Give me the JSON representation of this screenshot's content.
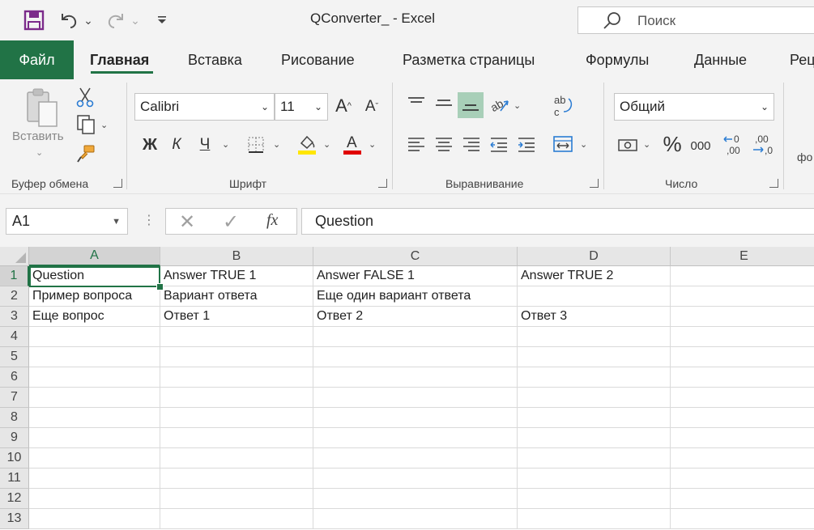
{
  "window": {
    "title": "QConverter_  -  Excel",
    "search_placeholder": "Поиск"
  },
  "ribbon_tabs": [
    "Файл",
    "Главная",
    "Вставка",
    "Рисование",
    "Разметка страницы",
    "Формулы",
    "Данные",
    "Рец"
  ],
  "active_tab": "Главная",
  "groups": {
    "clipboard": {
      "label": "Буфер обмена",
      "paste_label": "Вставить"
    },
    "font": {
      "label": "Шрифт",
      "font_name": "Calibri",
      "font_size": "11",
      "bold": "Ж",
      "italic": "К",
      "underline": "Ч"
    },
    "alignment": {
      "label": "Выравнивание"
    },
    "number": {
      "label": "Число",
      "format": "Общий",
      "thousands": "000"
    },
    "styles_partial": "фо"
  },
  "colors": {
    "accent": "#217346",
    "fill_highlight": "#ffe600",
    "font_color": "#e00000"
  },
  "formula_bar": {
    "name_box": "A1",
    "fx": "fx",
    "formula": "Question"
  },
  "grid": {
    "columns": [
      "A",
      "B",
      "C",
      "D",
      "E"
    ],
    "rows": [
      "1",
      "2",
      "3",
      "4",
      "5",
      "6",
      "7",
      "8",
      "9",
      "10",
      "11",
      "12",
      "13"
    ],
    "cells": [
      [
        "Question",
        "Answer TRUE 1",
        "Answer FALSE 1",
        "Answer TRUE 2",
        ""
      ],
      [
        "Пример вопроса",
        "Вариант ответа",
        "Еще один вариант ответа",
        "",
        ""
      ],
      [
        "Еще вопрос",
        "Ответ 1",
        "Ответ 2",
        "Ответ 3",
        ""
      ]
    ],
    "selected_cell": "A1"
  }
}
